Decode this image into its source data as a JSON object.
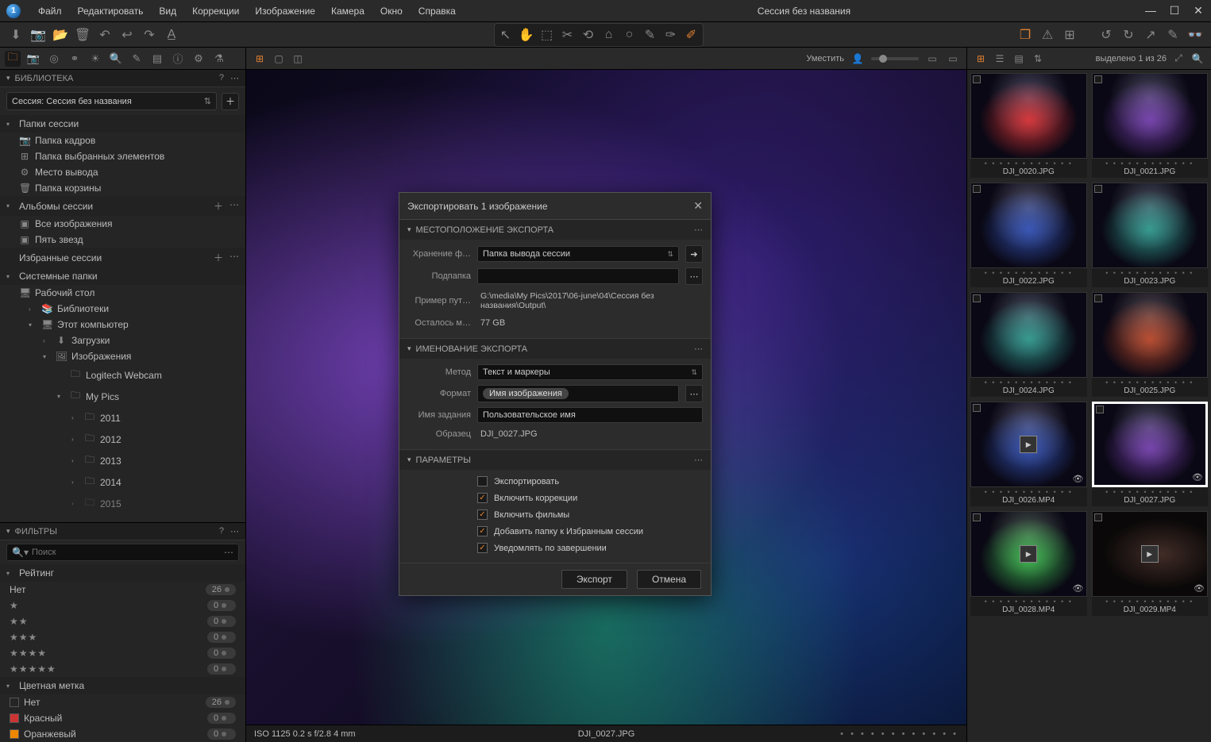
{
  "menu": {
    "file": "Файл",
    "edit": "Редактировать",
    "view": "Вид",
    "corrections": "Коррекции",
    "image": "Изображение",
    "camera": "Камера",
    "window": "Окно",
    "help": "Справка"
  },
  "session_title": "Сессия без названия",
  "library": {
    "hdr": "БИБЛИОТЕКА",
    "session_label": "Сессия:  Сессия без названия",
    "session_folders": "Папки сессии",
    "captures": "Папка кадров",
    "selects": "Папка выбранных элементов",
    "output": "Место вывода",
    "trash": "Папка корзины",
    "session_albums": "Альбомы сессии",
    "all_images": "Все изображения",
    "five_stars": "Пять звезд",
    "favorites": "Избранные сессии",
    "system_folders": "Системные папки",
    "desktop": "Рабочий стол",
    "libraries": "Библиотеки",
    "this_pc": "Этот компьютер",
    "downloads": "Загрузки",
    "images": "Изображения",
    "logitech": "Logitech Webcam",
    "mypics": "My Pics",
    "y2011": "2011",
    "y2012": "2012",
    "y2013": "2013",
    "y2014": "2014",
    "y2015": "2015"
  },
  "filters": {
    "hdr": "ФИЛЬТРЫ",
    "search_ph": "Поиск",
    "rating": "Рейтинг",
    "none": "Нет",
    "color_label": "Цветная метка",
    "clr_none": "Нет",
    "red": "Красный",
    "orange": "Оранжевый",
    "count26": "26",
    "count0": "0"
  },
  "viewer": {
    "fit": "Уместить",
    "info": "ISO 1125 0.2 s f/2.8 4 mm",
    "filename": "DJI_0027.JPG"
  },
  "browser": {
    "status": "выделено 1 из 26",
    "thumbs": [
      {
        "name": "DJI_0020.JPG",
        "cls": "tg-red"
      },
      {
        "name": "DJI_0021.JPG",
        "cls": "tg-purple"
      },
      {
        "name": "DJI_0022.JPG",
        "cls": "tg-blue"
      },
      {
        "name": "DJI_0023.JPG",
        "cls": "tg-teal"
      },
      {
        "name": "DJI_0024.JPG",
        "cls": "tg-teal"
      },
      {
        "name": "DJI_0025.JPG",
        "cls": "tg-orange"
      },
      {
        "name": "DJI_0026.MP4",
        "cls": "tg-blue",
        "video": true
      },
      {
        "name": "DJI_0027.JPG",
        "cls": "tg-purple",
        "selected": true
      },
      {
        "name": "DJI_0028.MP4",
        "cls": "tg-green",
        "video": true
      },
      {
        "name": "DJI_0029.MP4",
        "cls": "tg-dark",
        "video": true
      }
    ]
  },
  "export": {
    "title": "Экспортировать 1 изображение",
    "loc_hdr": "МЕСТОПОЛОЖЕНИЕ ЭКСПОРТА",
    "store_label": "Хранение ф…",
    "store_value": "Папка вывода сессии",
    "subfolder": "Подпапка",
    "path_label": "Пример пут…",
    "path_value": "G:\\media\\My Pics\\2017\\06-june\\04\\Сессия без названия\\Output\\",
    "space_label": "Осталось м…",
    "space_value": "77 GB",
    "naming_hdr": "ИМЕНОВАНИЕ ЭКСПОРТА",
    "method": "Метод",
    "method_value": "Текст и маркеры",
    "format": "Формат",
    "format_token": "Имя изображения",
    "job": "Имя задания",
    "job_value": "Пользовательское имя",
    "sample": "Образец",
    "sample_value": "DJI_0027.JPG",
    "params_hdr": "ПАРАМЕТРЫ",
    "chk_export": "Экспортировать",
    "chk_adjust": "Включить коррекции",
    "chk_movies": "Включить фильмы",
    "chk_favorites": "Добавить папку к Избранным сессии",
    "chk_notify": "Уведомлять по завершении",
    "btn_export": "Экспорт",
    "btn_cancel": "Отмена"
  }
}
